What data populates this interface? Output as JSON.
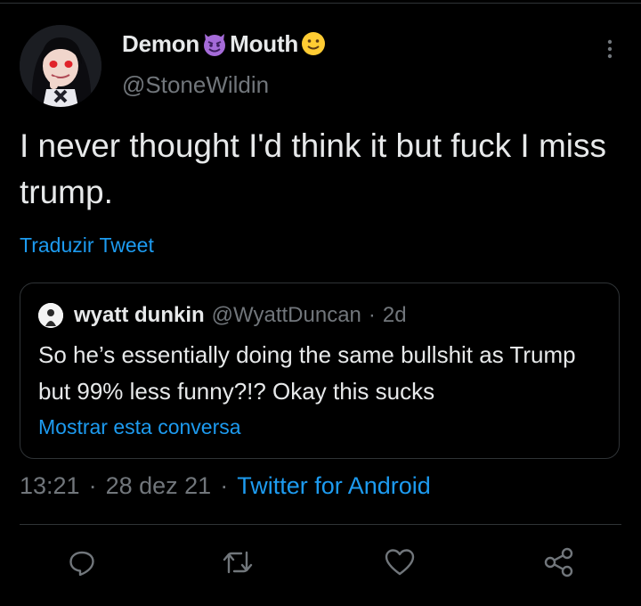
{
  "tweet": {
    "display_name_part1": "Demon",
    "display_name_part2": "Mouth",
    "handle": "@StoneWildin",
    "text": "I never thought I'd think it but fuck I miss trump.",
    "translate_label": "Traduzir Tweet",
    "time": "13:21",
    "date": "28 dez 21",
    "source": "Twitter for Android",
    "separator": "·"
  },
  "quoted_tweet": {
    "name": "wyatt dunkin",
    "handle": "@WyattDuncan",
    "separator": "·",
    "age": "2d",
    "text": "So he’s essentially doing the same bullshit as Trump but 99% less funny?!? Okay this sucks",
    "show_conversation_label": "Mostrar esta conversa"
  },
  "actions": [
    "reply-icon",
    "retweet-icon",
    "like-icon",
    "share-icon"
  ],
  "emojis": [
    "smiling-imp-emoji",
    "slightly-smiling-face-emoji"
  ],
  "colors": {
    "background": "#000000",
    "text": "#e7e9ea",
    "secondary": "#71767b",
    "link": "#1d9bf0",
    "border": "#2f3336",
    "imp_purple": "#a56bd8",
    "smiley_yellow": "#ffcc33"
  }
}
